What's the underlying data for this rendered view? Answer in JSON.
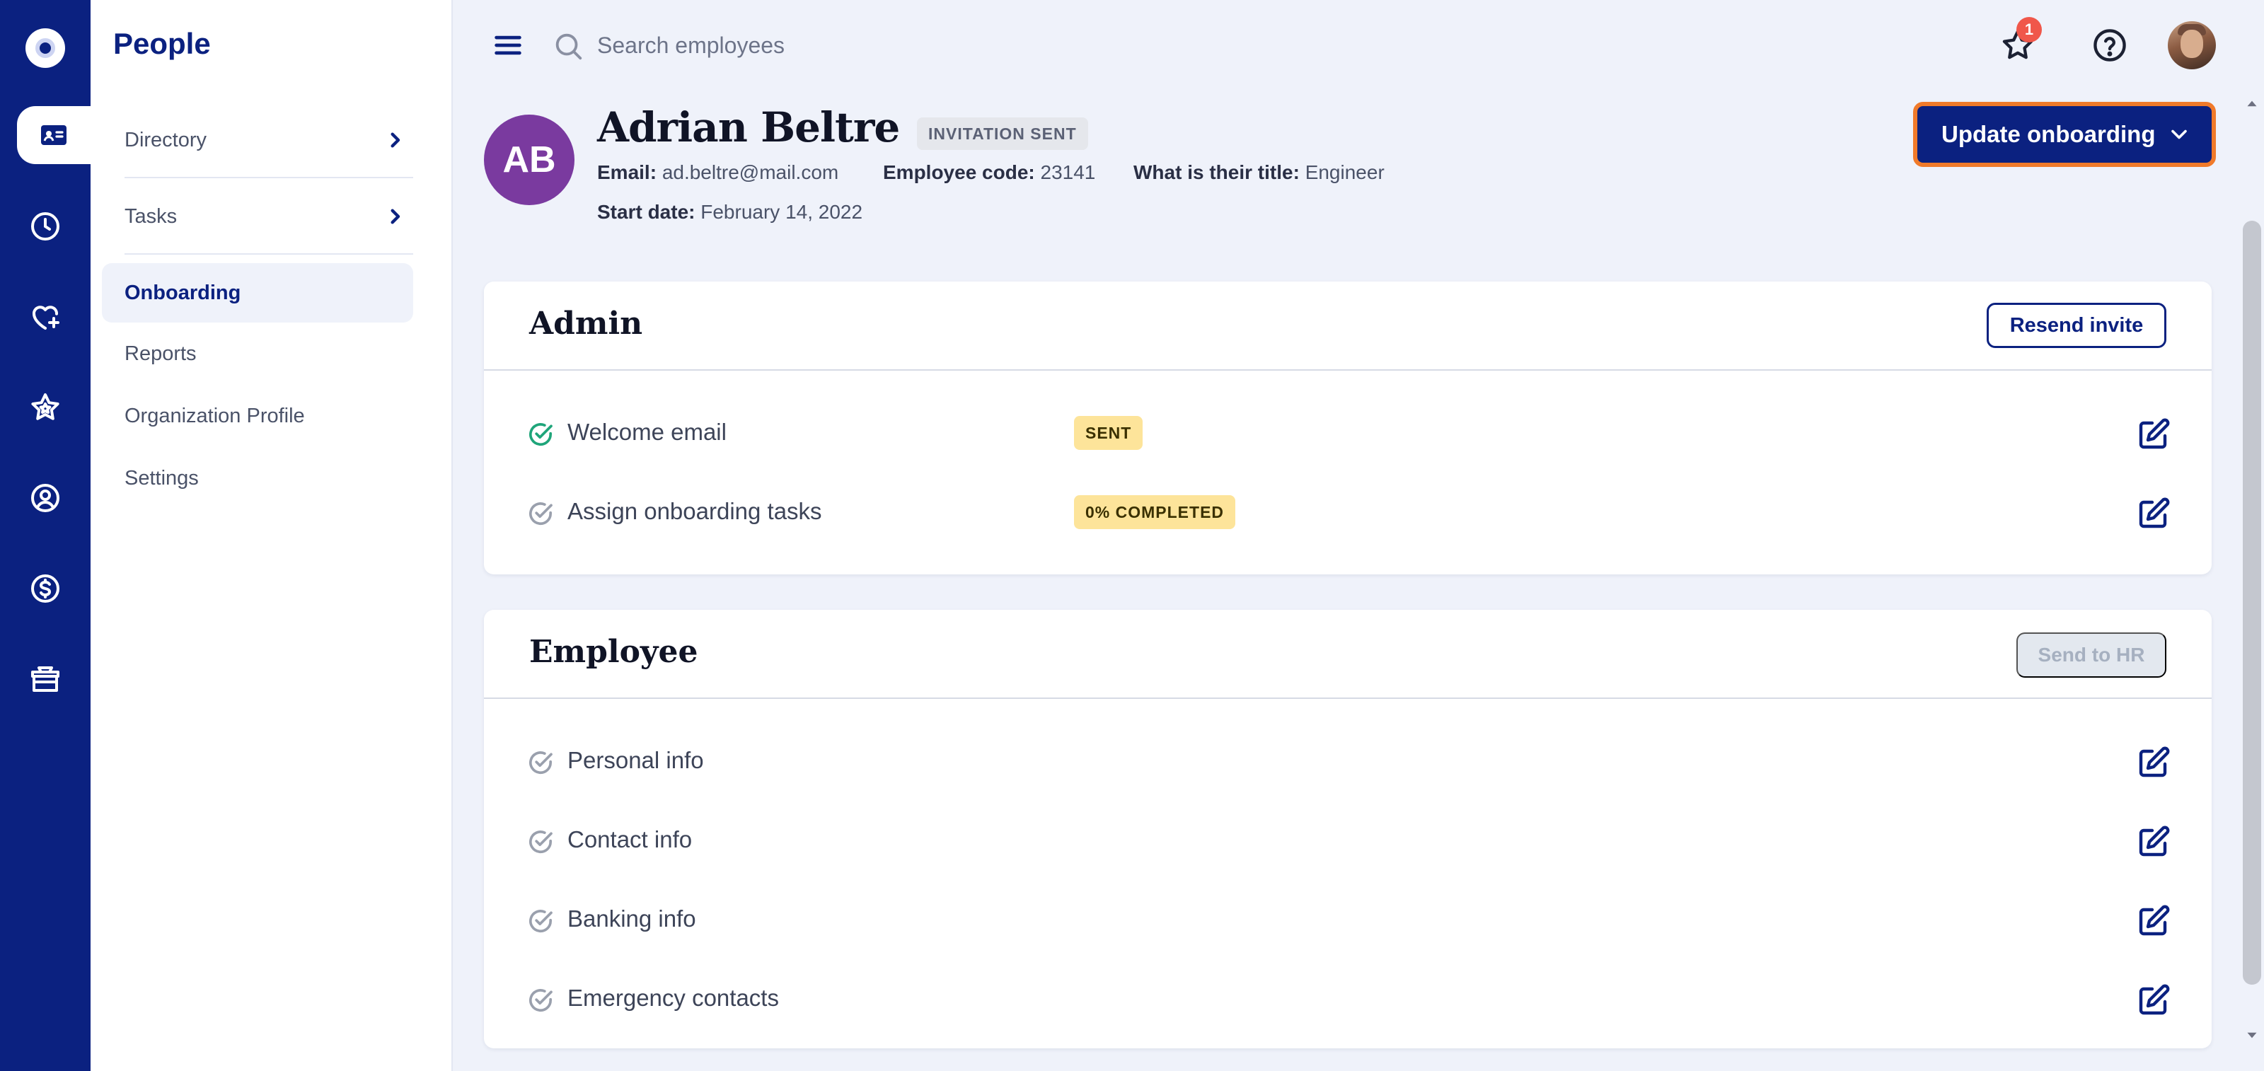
{
  "app": {
    "section_title": "People"
  },
  "rail": {
    "items": [
      {
        "icon": "app-logo-icon"
      },
      {
        "icon": "id-card-icon",
        "active": true
      },
      {
        "icon": "clock-icon"
      },
      {
        "icon": "heart-plus-icon"
      },
      {
        "icon": "star-icon"
      },
      {
        "icon": "user-search-icon"
      },
      {
        "icon": "dollar-circle-icon"
      },
      {
        "icon": "gift-box-icon"
      }
    ]
  },
  "sidebar": {
    "items": [
      {
        "label": "Directory",
        "expandable": true
      },
      {
        "label": "Tasks",
        "expandable": true
      },
      {
        "label": "Onboarding",
        "active": true
      },
      {
        "label": "Reports"
      },
      {
        "label": "Organization Profile"
      },
      {
        "label": "Settings"
      }
    ]
  },
  "topbar": {
    "search_placeholder": "Search employees",
    "notification_count": "1"
  },
  "employee": {
    "initials": "AB",
    "name": "Adrian Beltre",
    "status": "INVITATION SENT",
    "email_label": "Email:",
    "email": "ad.beltre@mail.com",
    "code_label": "Employee code:",
    "code": "23141",
    "title_label": "What is their title:",
    "title": "Engineer",
    "start_label": "Start date:",
    "start_date": "February 14, 2022"
  },
  "actions": {
    "update_label": "Update onboarding"
  },
  "admin_card": {
    "title": "Admin",
    "button_label": "Resend invite",
    "tasks": [
      {
        "label": "Welcome email",
        "status": "SENT",
        "done": true
      },
      {
        "label": "Assign onboarding tasks",
        "status": "0% COMPLETED",
        "done": false
      }
    ]
  },
  "employee_card": {
    "title": "Employee",
    "button_label": "Send to HR",
    "tasks": [
      {
        "label": "Personal info"
      },
      {
        "label": "Contact info"
      },
      {
        "label": "Banking info"
      },
      {
        "label": "Emergency contacts"
      }
    ]
  },
  "colors": {
    "brand": "#0b2180",
    "accent_focus": "#f07a2a",
    "avatar": "#7a3a9f",
    "chip_warning": "#fde49a",
    "check_done": "#1fa57a",
    "check_pending": "#9aa0ad"
  }
}
